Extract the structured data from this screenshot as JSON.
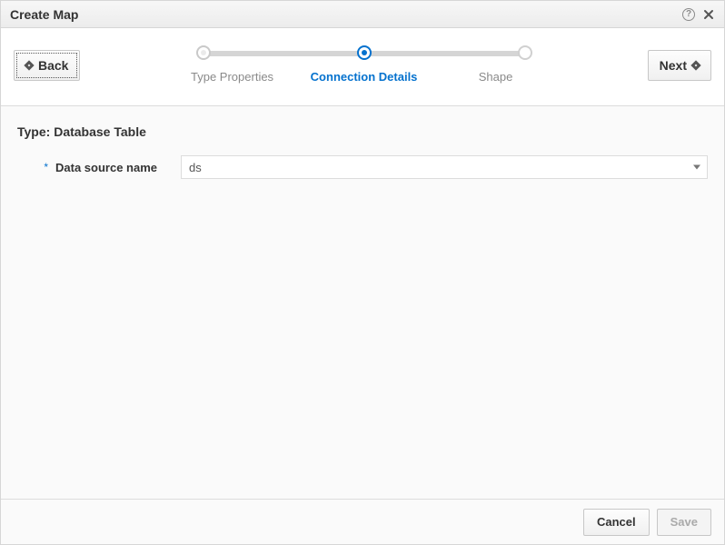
{
  "dialog": {
    "title": "Create Map"
  },
  "wizard": {
    "back_label": "Back",
    "next_label": "Next",
    "steps": {
      "step1": "Type Properties",
      "step2": "Connection Details",
      "step3": "Shape"
    }
  },
  "content": {
    "type_prefix": "Type:",
    "type_value": "Database Table",
    "required_mark": "*",
    "ds_label": "Data source name",
    "ds_value": "ds"
  },
  "footer": {
    "cancel_label": "Cancel",
    "save_label": "Save"
  }
}
